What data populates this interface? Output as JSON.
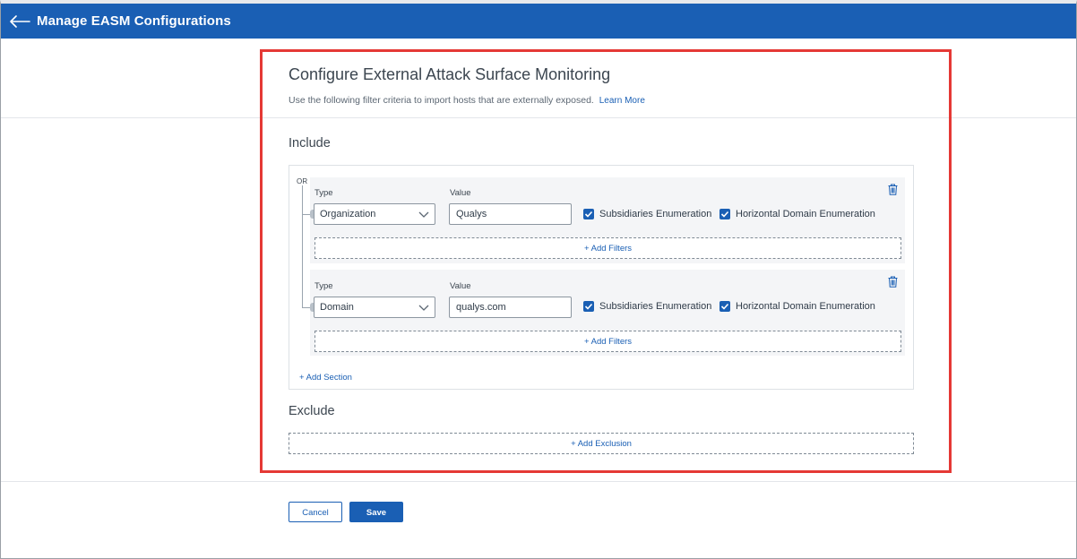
{
  "header": {
    "title": "Manage EASM Configurations",
    "back_icon": "arrow-left-icon"
  },
  "main": {
    "title": "Configure External Attack Surface Monitoring",
    "subtitle": "Use the following filter criteria to import hosts that are externally exposed.",
    "learn_more": "Learn More"
  },
  "include": {
    "heading": "Include",
    "operator": "OR",
    "filters": [
      {
        "type_label": "Type",
        "value_label": "Value",
        "type": "Organization",
        "value": "Qualys",
        "subsidiaries_label": "Subsidiaries Enumeration",
        "subsidiaries_checked": true,
        "horizontal_label": "Horizontal Domain Enumeration",
        "horizontal_checked": true,
        "add_filters": "+ Add Filters"
      },
      {
        "type_label": "Type",
        "value_label": "Value",
        "type": "Domain",
        "value": "qualys.com",
        "subsidiaries_label": "Subsidiaries Enumeration",
        "subsidiaries_checked": true,
        "horizontal_label": "Horizontal Domain Enumeration",
        "horizontal_checked": true,
        "add_filters": "+ Add Filters"
      }
    ],
    "add_section": "+ Add Section"
  },
  "exclude": {
    "heading": "Exclude",
    "add_exclusion": "+ Add Exclusion"
  },
  "footer": {
    "cancel": "Cancel",
    "save": "Save"
  },
  "colors": {
    "brand": "#1a5fb4",
    "highlight": "#e53935"
  }
}
